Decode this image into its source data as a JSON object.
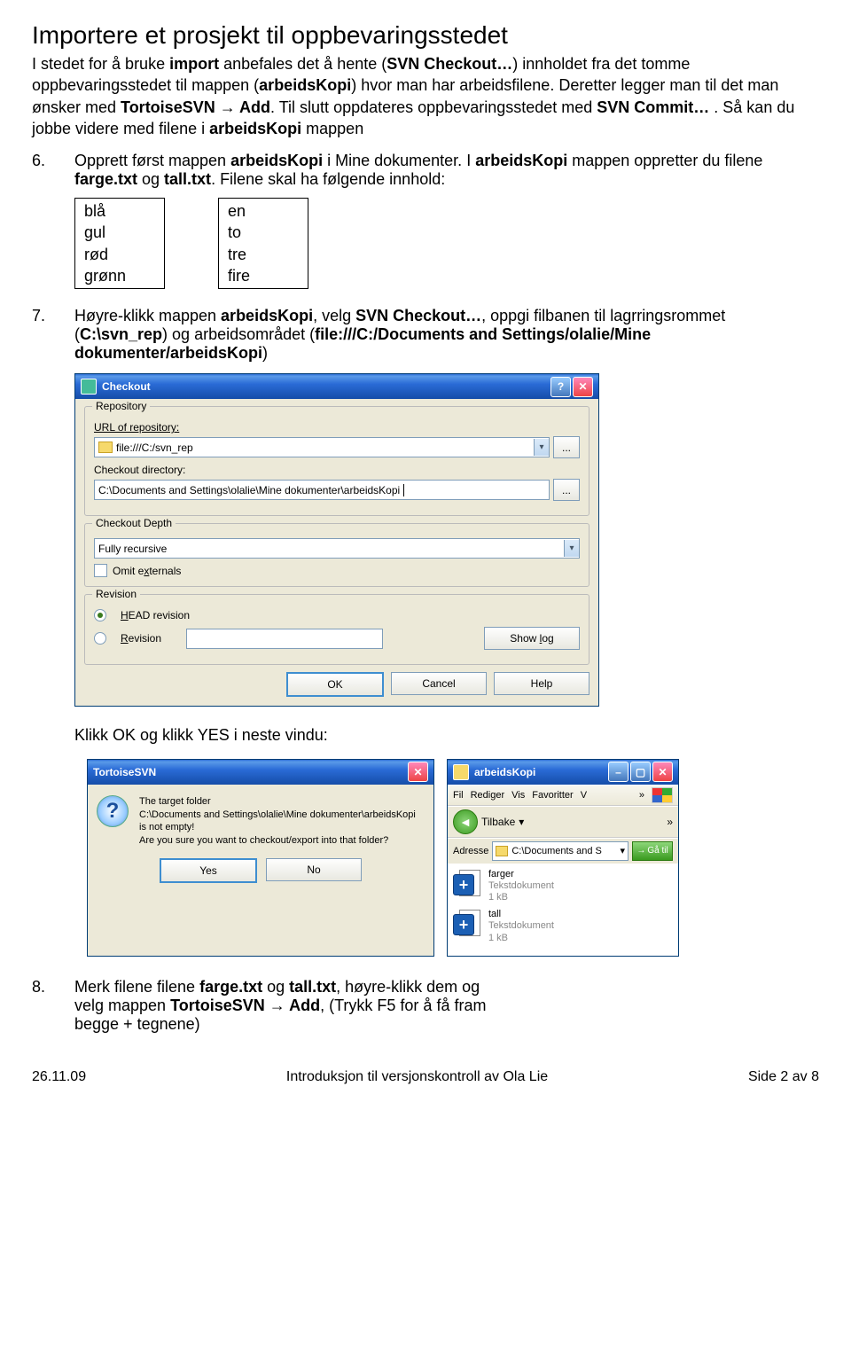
{
  "title": "Importere et prosjekt til oppbevaringsstedet",
  "intro": {
    "pre": "I stedet for å bruke ",
    "w1": "import",
    "mid1": " anbefales det å hente (",
    "w2": "SVN Checkout…",
    "mid2": ") innholdet fra det tomme oppbevaringsstedet til mappen (",
    "w3": "arbeidsKopi",
    "mid3": ") hvor man har arbeidsfilene. Deretter legger man til det man ønsker med ",
    "w4": "TortoiseSVN → Add",
    "mid4": ". Til slutt oppdateres oppbevaringsstedet med ",
    "w5": "SVN Commit…",
    "mid5": " . Så kan du jobbe videre med filene i ",
    "w6": "arbeidsKopi",
    "end": " mappen"
  },
  "step6": {
    "num": "6.",
    "t1": "Opprett først mappen ",
    "w1": "arbeidsKopi",
    "t2": " i Mine dokumenter. I ",
    "w2": "arbeidsKopi",
    "t3": " mappen oppretter du filene ",
    "w3": "farge.txt",
    "t4": " og ",
    "w4": "tall.txt",
    "t5": ". Filene skal ha følgende innhold:"
  },
  "box1": [
    "blå",
    "gul",
    "rød",
    "grønn"
  ],
  "box2": [
    "en",
    "to",
    "tre",
    "fire"
  ],
  "step7": {
    "num": "7.",
    "t1": "Høyre-klikk mappen ",
    "w1": "arbeidsKopi",
    "t2": ", velg ",
    "w2": "SVN Checkout…",
    "t3": ", oppgi filbanen til lagrringsrommet (",
    "w3": "C:\\svn_rep",
    "t4": ") og arbeidsområdet (",
    "w4": "file:///C:/Documents and Settings/olalie/Mine dokumenter/arbeidsKopi",
    "t5": ")"
  },
  "checkout": {
    "title": "Checkout",
    "group1": "Repository",
    "url_label": "URL of repository:",
    "url_value": "file:///C:/svn_rep",
    "dir_label": "Checkout directory:",
    "dir_value": "C:\\Documents and Settings\\olalie\\Mine dokumenter\\arbeidsKopi",
    "group2": "Checkout Depth",
    "depth_value": "Fully recursive",
    "omit": "Omit externals",
    "group3": "Revision",
    "head": "HEAD revision",
    "rev": "Revision",
    "showlog": "Show log",
    "ok": "OK",
    "cancel": "Cancel",
    "help": "Help"
  },
  "afterdlg": "Klikk OK og klikk YES i neste vindu:",
  "msgbox": {
    "title": "TortoiseSVN",
    "line1": "The target folder",
    "line2": "C:\\Documents and Settings\\olalie\\Mine dokumenter\\arbeidsKopi",
    "line3": "is not empty!",
    "line4": "Are you sure you want to checkout/export into that folder?",
    "yes": "Yes",
    "no": "No"
  },
  "explorer": {
    "title": "arbeidsKopi",
    "menu": [
      "Fil",
      "Rediger",
      "Vis",
      "Favoritter",
      "V"
    ],
    "back": "Tilbake",
    "addr_lbl": "Adresse",
    "addr_val": "C:\\Documents and S",
    "go": "Gå til",
    "files": [
      {
        "name": "farger",
        "type": "Tekstdokument",
        "size": "1 kB"
      },
      {
        "name": "tall",
        "type": "Tekstdokument",
        "size": "1 kB"
      }
    ]
  },
  "step8": {
    "num": "8.",
    "t1": "Merk filene filene ",
    "w1": "farge.txt",
    "t2": " og ",
    "w2": "tall.txt",
    "t3": ", høyre-klikk dem og velg mappen ",
    "w3": "TortoiseSVN → Add",
    "t4": ", (Trykk F5 for å få fram begge + tegnene)"
  },
  "footer": {
    "left": "26.11.09",
    "center": "Introduksjon til versjonskontroll av Ola Lie",
    "right": "Side 2 av 8"
  }
}
